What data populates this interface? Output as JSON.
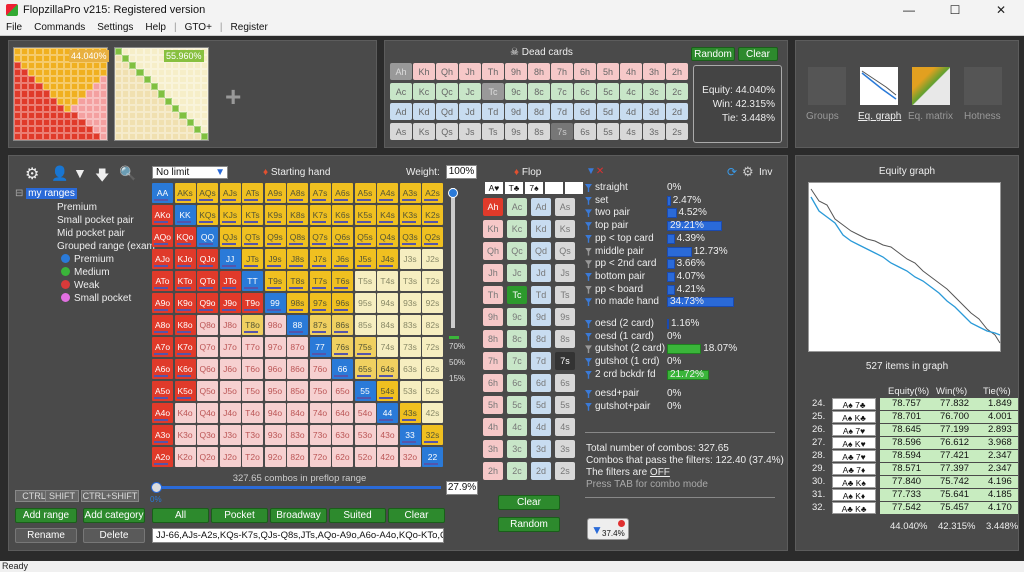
{
  "window": {
    "title": "FlopzillaPro v215: Registered version"
  },
  "menu": [
    "File",
    "Commands",
    "Settings",
    "Help",
    "|",
    "GTO+",
    "|",
    "Register"
  ],
  "status": "Ready",
  "top_left": {
    "range1_pct": "44.040%",
    "range2_pct": "55.960%"
  },
  "dead_cards": {
    "title": "Dead cards",
    "random": "Random",
    "clear": "Clear",
    "rows": [
      [
        "Ah",
        "Kh",
        "Qh",
        "Jh",
        "Th",
        "9h",
        "8h",
        "7h",
        "6h",
        "5h",
        "4h",
        "3h",
        "2h"
      ],
      [
        "Ac",
        "Kc",
        "Qc",
        "Jc",
        "Tc",
        "9c",
        "8c",
        "7c",
        "6c",
        "5c",
        "4c",
        "3c",
        "2c"
      ],
      [
        "Ad",
        "Kd",
        "Qd",
        "Jd",
        "Td",
        "9d",
        "8d",
        "7d",
        "6d",
        "5d",
        "4d",
        "3d",
        "2d"
      ],
      [
        "As",
        "Ks",
        "Qs",
        "Js",
        "Ts",
        "9s",
        "8s",
        "7s",
        "6s",
        "5s",
        "4s",
        "3s",
        "2s"
      ]
    ]
  },
  "equity_box": {
    "equity": "Equity: 44.040%",
    "win": "Win: 42.315%",
    "tie": "Tie: 3.448%"
  },
  "top_right_tabs": [
    "Groups",
    "Eq. graph",
    "Eq. matrix",
    "Hotness"
  ],
  "tree": {
    "root": "my ranges",
    "items": [
      "Premium",
      "Small pocket pair",
      "Mid pocket pair",
      "Grouped range (exam"
    ],
    "sub": [
      "Premium",
      "Medium",
      "Weak",
      "Small pocket"
    ],
    "colors": [
      "#2a7ad8",
      "#3ab53a",
      "#d83a3a",
      "#e070e0"
    ]
  },
  "keys": [
    "CTRL",
    "SHIFT",
    "CTRL+SHIFT"
  ],
  "left_buttons": [
    "Add range",
    "Add category",
    "Rename",
    "Delete"
  ],
  "range": {
    "limit": "No limit",
    "starting_hand": "Starting hand",
    "weight_label": "Weight:",
    "weight": "100%",
    "combos_text": "327.65 combos in preflop range",
    "pct": "27.9%",
    "slider_min": "0%",
    "marks": [
      "70%",
      "50%",
      "15%"
    ],
    "buttons": [
      "All",
      "Pocket",
      "Broadway",
      "Suited",
      "Clear"
    ],
    "text": "JJ-66,AJs-A2s,KQs-K7s,QJs-Q8s,JTs,AQo-A9o,A6o-A4o,KQo-KTo,QJo"
  },
  "grid": [
    [
      "AA",
      "AKs",
      "AQs",
      "AJs",
      "ATs",
      "A9s",
      "A8s",
      "A7s",
      "A6s",
      "A5s",
      "A4s",
      "A3s",
      "A2s"
    ],
    [
      "AKo",
      "KK",
      "KQs",
      "KJs",
      "KTs",
      "K9s",
      "K8s",
      "K7s",
      "K6s",
      "K5s",
      "K4s",
      "K3s",
      "K2s"
    ],
    [
      "AQo",
      "KQo",
      "QQ",
      "QJs",
      "QTs",
      "Q9s",
      "Q8s",
      "Q7s",
      "Q6s",
      "Q5s",
      "Q4s",
      "Q3s",
      "Q2s"
    ],
    [
      "AJo",
      "KJo",
      "QJo",
      "JJ",
      "JTs",
      "J9s",
      "J8s",
      "J7s",
      "J6s",
      "J5s",
      "J4s",
      "J3s",
      "J2s"
    ],
    [
      "ATo",
      "KTo",
      "QTo",
      "JTo",
      "TT",
      "T9s",
      "T8s",
      "T7s",
      "T6s",
      "T5s",
      "T4s",
      "T3s",
      "T2s"
    ],
    [
      "A9o",
      "K9o",
      "Q9o",
      "J9o",
      "T9o",
      "99",
      "98s",
      "97s",
      "96s",
      "95s",
      "94s",
      "93s",
      "92s"
    ],
    [
      "A8o",
      "K8o",
      "Q8o",
      "J8o",
      "T8o",
      "98o",
      "88",
      "87s",
      "86s",
      "85s",
      "84s",
      "83s",
      "82s"
    ],
    [
      "A7o",
      "K7o",
      "Q7o",
      "J7o",
      "T7o",
      "97o",
      "87o",
      "77",
      "76s",
      "75s",
      "74s",
      "73s",
      "72s"
    ],
    [
      "A6o",
      "K6o",
      "Q6o",
      "J6o",
      "T6o",
      "96o",
      "86o",
      "76o",
      "66",
      "65s",
      "64s",
      "63s",
      "62s"
    ],
    [
      "A5o",
      "K5o",
      "Q5o",
      "J5o",
      "T5o",
      "95o",
      "85o",
      "75o",
      "65o",
      "55",
      "54s",
      "53s",
      "52s"
    ],
    [
      "A4o",
      "K4o",
      "Q4o",
      "J4o",
      "T4o",
      "94o",
      "84o",
      "74o",
      "64o",
      "54o",
      "44",
      "43s",
      "42s"
    ],
    [
      "A3o",
      "K3o",
      "Q3o",
      "J3o",
      "T3o",
      "93o",
      "83o",
      "73o",
      "63o",
      "53o",
      "43o",
      "33",
      "32s"
    ],
    [
      "A2o",
      "K2o",
      "Q2o",
      "J2o",
      "T2o",
      "92o",
      "82o",
      "72o",
      "62o",
      "52o",
      "42o",
      "32o",
      "22"
    ]
  ],
  "flop": {
    "title": "Flop",
    "cards": [
      "A♥",
      "T♣",
      "7♠"
    ],
    "col_h": [
      "Ah",
      "Kh",
      "Qh",
      "Jh",
      "Th",
      "9h",
      "8h",
      "7h",
      "6h",
      "5h",
      "4h",
      "3h",
      "2h"
    ],
    "col_c": [
      "Ac",
      "Kc",
      "Qc",
      "Jc",
      "Tc",
      "9c",
      "8c",
      "7c",
      "6c",
      "5c",
      "4c",
      "3c",
      "2c"
    ],
    "col_d": [
      "Ad",
      "Kd",
      "Qd",
      "Jd",
      "Td",
      "9d",
      "8d",
      "7d",
      "6d",
      "5d",
      "4d",
      "3d",
      "2d"
    ],
    "col_s": [
      "As",
      "Ks",
      "Qs",
      "Js",
      "Ts",
      "9s",
      "8s",
      "7s",
      "6s",
      "5s",
      "4s",
      "3s",
      "2s"
    ],
    "clear": "Clear",
    "random": "Random"
  },
  "stats": {
    "inv": "Inv",
    "rows": [
      {
        "label": "straight",
        "pct": "0%",
        "frac": 0
      },
      {
        "label": "set",
        "pct": "2.47%",
        "frac": 0.02
      },
      {
        "label": "two pair",
        "pct": "4.52%",
        "frac": 0.05
      },
      {
        "label": "top pair",
        "pct": "29.21%",
        "frac": 0.29
      },
      {
        "label": "pp < top card",
        "pct": "4.39%",
        "frac": 0.04
      },
      {
        "label": "middle pair",
        "pct": "12.73%",
        "frac": 0.13
      },
      {
        "label": "pp < 2nd card",
        "pct": "3.66%",
        "frac": 0.04
      },
      {
        "label": "bottom pair",
        "pct": "4.07%",
        "frac": 0.04
      },
      {
        "label": "pp < board",
        "pct": "4.21%",
        "frac": 0.04
      },
      {
        "label": "no made hand",
        "pct": "34.73%",
        "frac": 0.35
      }
    ],
    "draws": [
      {
        "label": "oesd (2 card)",
        "pct": "1.16%",
        "frac": 0.01
      },
      {
        "label": "oesd (1 card)",
        "pct": "0%",
        "frac": 0
      },
      {
        "label": "gutshot (2 card)",
        "pct": "18.07%",
        "frac": 0.18
      },
      {
        "label": "gutshot (1 crd)",
        "pct": "0%",
        "frac": 0
      },
      {
        "label": "2 crd bckdr fd",
        "pct": "21.72%",
        "frac": 0.22
      }
    ],
    "combined": [
      {
        "label": "oesd+pair",
        "pct": "0%"
      },
      {
        "label": "gutshot+pair",
        "pct": "0%"
      }
    ],
    "total": "Total number of combos: 327.65",
    "pass": "Combos that pass the filters: 122.40 (37.4%)",
    "filters_pre": "The filters are ",
    "filters_off": "OFF",
    "tab_hint": "Press TAB for combo mode",
    "badge": "37.4%"
  },
  "graph": {
    "title": "Equity graph",
    "items": "527 items in graph"
  },
  "eq_table": {
    "headers": [
      "Equity(%)",
      "Win(%)",
      "Tie(%)"
    ],
    "rows": [
      {
        "n": "24.",
        "c1": "A♠",
        "c2": "7♣",
        "eq": "78.757",
        "win": "77.832",
        "tie": "1.849"
      },
      {
        "n": "25.",
        "c1": "A♠",
        "c2": "K♣",
        "eq": "78.701",
        "win": "76.700",
        "tie": "4.001"
      },
      {
        "n": "26.",
        "c1": "A♠",
        "c2": "7♥",
        "eq": "78.645",
        "win": "77.199",
        "tie": "2.893"
      },
      {
        "n": "27.",
        "c1": "A♠",
        "c2": "K♥",
        "eq": "78.596",
        "win": "76.612",
        "tie": "3.968"
      },
      {
        "n": "28.",
        "c1": "A♣",
        "c2": "7♥",
        "eq": "78.594",
        "win": "77.421",
        "tie": "2.347"
      },
      {
        "n": "29.",
        "c1": "A♣",
        "c2": "7♦",
        "eq": "78.571",
        "win": "77.397",
        "tie": "2.347"
      },
      {
        "n": "30.",
        "c1": "A♣",
        "c2": "K♠",
        "eq": "77.840",
        "win": "75.742",
        "tie": "4.196"
      },
      {
        "n": "31.",
        "c1": "A♠",
        "c2": "K♦",
        "eq": "77.733",
        "win": "75.641",
        "tie": "4.185"
      },
      {
        "n": "32.",
        "c1": "A♣",
        "c2": "K♣",
        "eq": "77.542",
        "win": "75.457",
        "tie": "4.170"
      }
    ],
    "totals": {
      "eq": "44.040%",
      "win": "42.315%",
      "tie": "3.448%"
    }
  }
}
